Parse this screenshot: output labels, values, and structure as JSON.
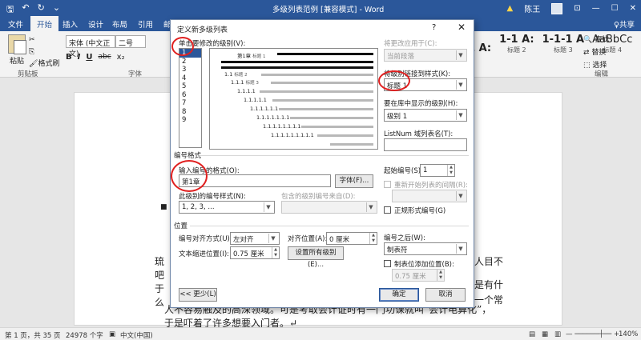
{
  "titlebar": {
    "doc_title": "多级列表范例 [兼容模式] - Word",
    "warning": "▲",
    "user": "陈王"
  },
  "tabs": [
    "文件",
    "开始",
    "插入",
    "设计",
    "布局",
    "引用",
    "邮"
  ],
  "share": "♀共享",
  "ribbon": {
    "paste": "粘贴",
    "format_painter": "格式刷",
    "clipboard_group": "剪贴板",
    "font_name": "宋体 (中文正文)",
    "font_size": "二号",
    "font_group": "字体",
    "format_buttons": [
      "B",
      "I",
      "U",
      "abc",
      "x₂"
    ],
    "styles": [
      {
        "sample": "1 A:",
        "name": ""
      },
      {
        "sample": "1-1 A:",
        "name": "标题 2"
      },
      {
        "sample": "1-1-1 A",
        "name": "标题 3"
      },
      {
        "sample": "AaBbCc",
        "name": "标题 4"
      }
    ],
    "find": "查找",
    "replace": "替换",
    "select": "选择",
    "edit_group": "编辑"
  },
  "dialog": {
    "title": "定义新多级列表",
    "help": "?",
    "close": "✕",
    "level_label": "单击要修改的级别(V):",
    "levels": [
      "1",
      "2",
      "3",
      "4",
      "5",
      "6",
      "7",
      "8",
      "9"
    ],
    "selected_level": "1",
    "preview": {
      "level1": "第1章",
      "level1_style": "标题 1",
      "rows": [
        {
          "num": "1.1",
          "style": "标题 2"
        },
        {
          "num": "1.1.1",
          "style": "标题 3"
        },
        {
          "num": "1.1.1.1",
          "style": ""
        },
        {
          "num": "1.1.1.1.1",
          "style": ""
        },
        {
          "num": "1.1.1.1.1.1",
          "style": ""
        },
        {
          "num": "1.1.1.1.1.1.1",
          "style": ""
        },
        {
          "num": "1.1.1.1.1.1.1.1",
          "style": ""
        },
        {
          "num": "1.1.1.1.1.1.1.1.1",
          "style": ""
        }
      ]
    },
    "apply_to_label": "将更改应用于(C):",
    "apply_to_value": "当前段落",
    "link_style_label": "将级别链接到样式(K):",
    "link_style_value": "标题 1",
    "gallery_level_label": "要在库中显示的级别(H):",
    "gallery_level_value": "级别 1",
    "listnum_label": "ListNum 域列表名(T):",
    "listnum_value": "",
    "number_format_section": "编号格式",
    "enter_format_label": "输入编号的格式(O):",
    "enter_format_value": "第1章",
    "font_button": "字体(F)...",
    "number_style_label": "此级别的编号样式(N):",
    "number_style_value": "1, 2, 3, ...",
    "include_from_label": "包含的级别编号来自(D):",
    "start_at_label": "起始编号(S):",
    "start_at_value": "1",
    "restart_label": "重新开始列表的间隔(R):",
    "legal_label": "正规形式编号(G)",
    "position_section": "位置",
    "alignment_label": "编号对齐方式(U):",
    "alignment_value": "左对齐",
    "aligned_at_label": "对齐位置(A):",
    "aligned_at_value": "0 厘米",
    "follow_label": "编号之后(W):",
    "follow_value": "制表符",
    "indent_label": "文本缩进位置(I):",
    "indent_value": "0.75 厘米",
    "set_all_button": "设置所有级别(E)...",
    "tab_stop_label": "制表位添加位置(B):",
    "tab_stop_value": "0.75 厘米",
    "less_button": "<< 更少(L)",
    "ok_button": "确定",
    "cancel_button": "取消"
  },
  "document": {
    "right_lines": [
      "令人目不",
      "或是有什",
      "是一个常"
    ],
    "left_fragments": [
      "琉",
      "吧",
      "于",
      "么"
    ],
    "bottom_lines": [
      "人不容易触及的高深领域。可是考取会计证时有一门功课就叫“会计电算化”，",
      "于是吓着了许多想要入门者。↵"
    ]
  },
  "status": {
    "page": "第 1 页，共 35 页",
    "words": "24978 个字",
    "lang": "中文(中国)",
    "zoom": "140%"
  },
  "colors": {
    "accent": "#2b579a",
    "annotation": "#e02020"
  }
}
